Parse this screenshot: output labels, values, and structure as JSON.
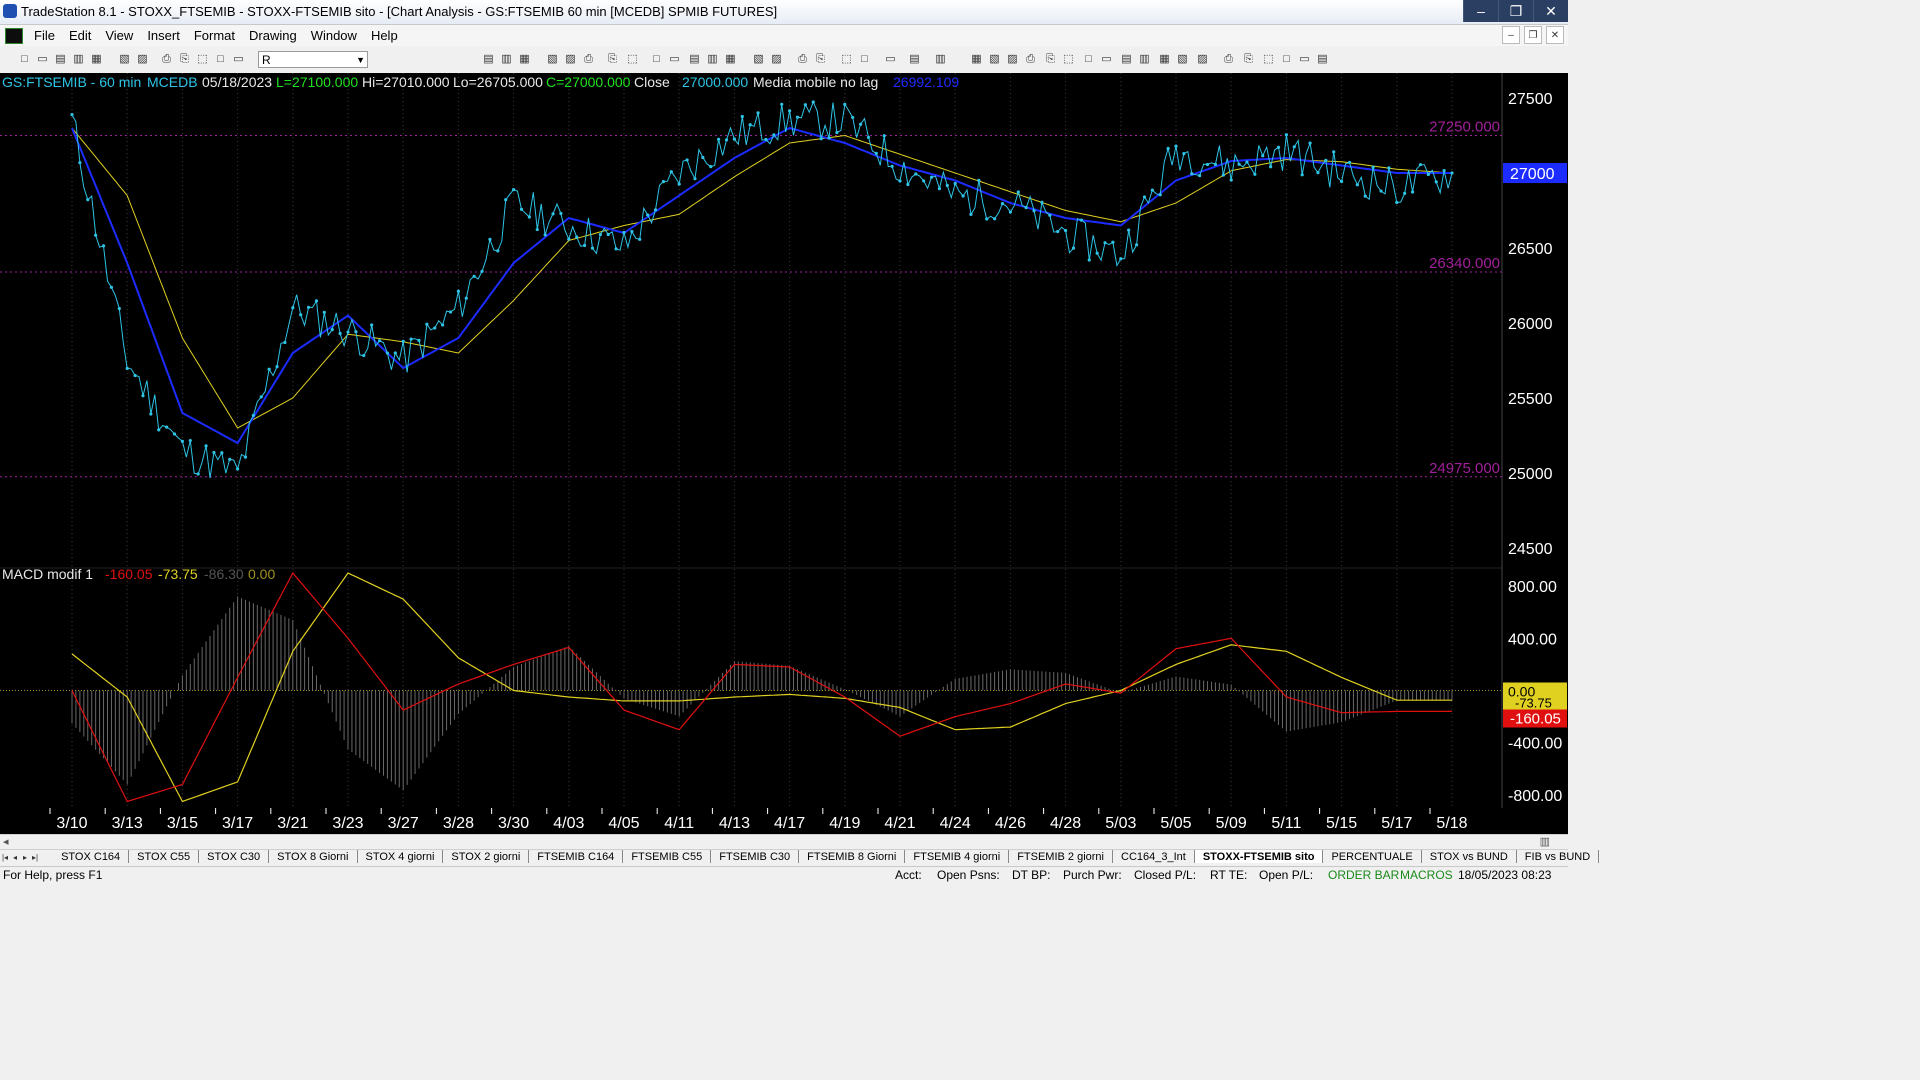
{
  "window": {
    "title": "TradeStation 8.1 - STOXX_FTSEMIB - STOXX-FTSEMIB sito - [Chart Analysis - GS:FTSEMIB  60 min  [MCEDB] SPMIB FUTURES]",
    "buttons": [
      "–",
      "❐",
      "✕"
    ]
  },
  "menu": [
    "File",
    "Edit",
    "View",
    "Insert",
    "Format",
    "Drawing",
    "Window",
    "Help"
  ],
  "toolbar": {
    "symbol_value": "R"
  },
  "chart_header": {
    "symbol": "GS:FTSEMIB - 60 min",
    "exchange": "MCEDB",
    "date": "05/18/2023",
    "low_label": "L=27100.000",
    "high_label": "Hi=27010.000",
    "lo_label": "Lo=26705.000",
    "close_label": "C=27000.000",
    "close_word": "Close",
    "close_value": "27000.000",
    "ma_name": "Media mobile no lag",
    "ma_value": "26992.109"
  },
  "macd_header": {
    "name": "MACD modif 1",
    "v1": "-160.05",
    "v2": "-73.75",
    "v3": "-86.30",
    "v4": "0.00"
  },
  "price_levels": [
    {
      "label": "27250.000",
      "value": 27250
    },
    {
      "label": "26340.000",
      "value": 26340
    },
    {
      "label": "24975.000",
      "value": 24975
    }
  ],
  "price_axis": [
    "27500",
    "27000",
    "26500",
    "26000",
    "25500",
    "25000",
    "24500"
  ],
  "last_price_label": "27000",
  "macd_axis": [
    "800.00",
    "400.00",
    "0.00",
    "-400.00",
    "-800.00"
  ],
  "macd_badges": [
    "-73.75",
    "-160.05",
    "0.00"
  ],
  "dates": [
    "3/10",
    "3/13",
    "3/15",
    "3/17",
    "3/21",
    "3/23",
    "3/27",
    "3/28",
    "3/30",
    "4/03",
    "4/05",
    "4/11",
    "4/13",
    "4/17",
    "4/19",
    "4/21",
    "4/24",
    "4/26",
    "4/28",
    "5/03",
    "5/05",
    "5/09",
    "5/11",
    "5/15",
    "5/17",
    "5/18"
  ],
  "colors": {
    "price": "#2ec4e6",
    "ma_blue": "#1c2bff",
    "ma_yellow": "#e0d020",
    "macd_red": "#e01010",
    "macd_yellow": "#e0d020",
    "level": "#a0209a",
    "last_price_bg": "#1c2bff"
  },
  "chart_data": [
    {
      "type": "line",
      "name": "GS:FTSEMIB - 60 min",
      "x": [
        "3/10",
        "3/13",
        "3/15",
        "3/17",
        "3/21",
        "3/23",
        "3/27",
        "3/28",
        "3/30",
        "4/03",
        "4/05",
        "4/11",
        "4/13",
        "4/17",
        "4/19",
        "4/21",
        "4/24",
        "4/26",
        "4/28",
        "5/03",
        "5/05",
        "5/09",
        "5/11",
        "5/15",
        "5/17",
        "5/18"
      ],
      "series": [
        {
          "name": "price",
          "values": [
            27350,
            25750,
            25150,
            25000,
            26100,
            25950,
            25750,
            26100,
            26800,
            26650,
            26500,
            27000,
            27250,
            27350,
            27350,
            27050,
            26850,
            26800,
            26600,
            26450,
            27150,
            27050,
            27150,
            27000,
            26900,
            27000
          ]
        },
        {
          "name": "Media mobile no lag",
          "values": [
            27300,
            26400,
            25400,
            25200,
            25800,
            26050,
            25700,
            25900,
            26400,
            26700,
            26600,
            26850,
            27100,
            27300,
            27200,
            27050,
            26950,
            26800,
            26700,
            26650,
            26950,
            27080,
            27100,
            27050,
            27000,
            27000
          ]
        }
      ],
      "ylim": [
        24400,
        27600
      ]
    },
    {
      "type": "line",
      "name": "MACD modif 1",
      "x": [
        "3/10",
        "3/13",
        "3/15",
        "3/17",
        "3/21",
        "3/23",
        "3/27",
        "3/28",
        "3/30",
        "4/03",
        "4/05",
        "4/11",
        "4/13",
        "4/17",
        "4/19",
        "4/21",
        "4/24",
        "4/26",
        "4/28",
        "5/03",
        "5/05",
        "5/09",
        "5/11",
        "5/15",
        "5/17",
        "5/18"
      ],
      "series": [
        {
          "name": "MACD",
          "values": [
            0,
            -850,
            -720,
            100,
            900,
            400,
            -150,
            50,
            200,
            330,
            -150,
            -300,
            200,
            180,
            -50,
            -350,
            -200,
            -100,
            50,
            -20,
            320,
            400,
            -50,
            -170,
            -160,
            -160
          ]
        },
        {
          "name": "Signal",
          "values": [
            280,
            -50,
            -850,
            -700,
            300,
            900,
            700,
            250,
            0,
            -50,
            -80,
            -80,
            -50,
            -30,
            -60,
            -130,
            -300,
            -280,
            -100,
            0,
            200,
            350,
            300,
            100,
            -74,
            -74
          ]
        }
      ],
      "ylim": [
        -900,
        900
      ]
    }
  ]
}
